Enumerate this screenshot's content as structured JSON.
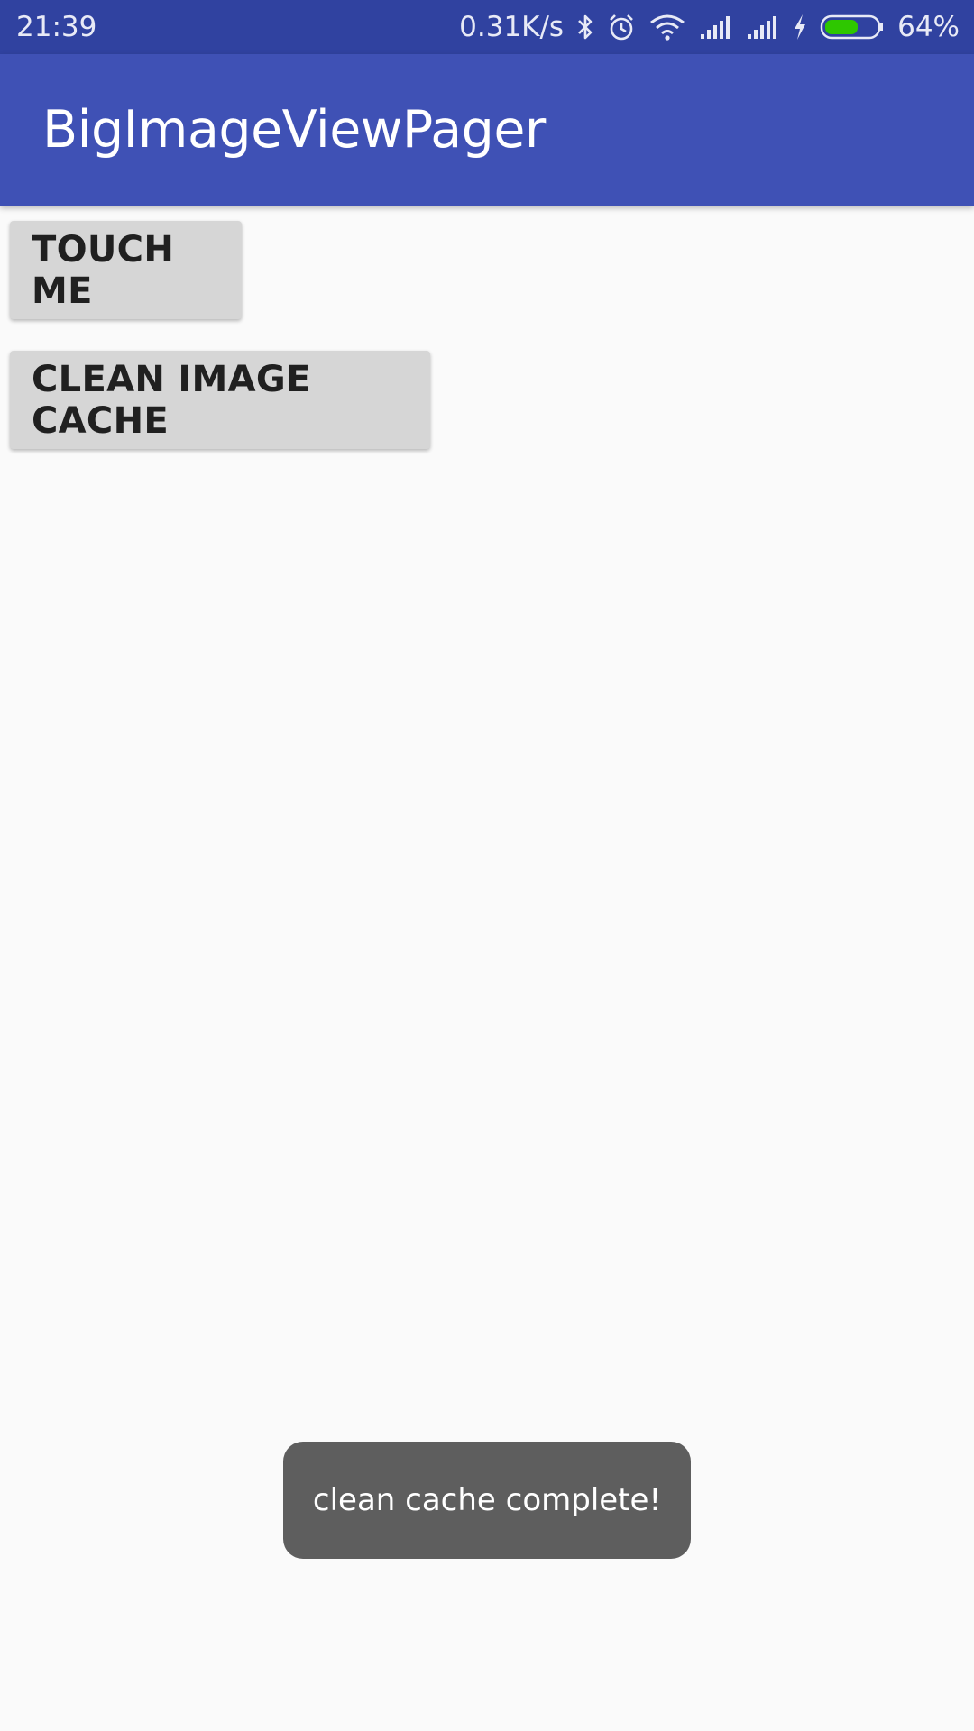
{
  "status_bar": {
    "time": "21:39",
    "network_speed": "0.31K/s",
    "battery_percent": "64%",
    "battery_level": 0.64,
    "icons": [
      "bluetooth-icon",
      "alarm-icon",
      "wifi-icon",
      "signal-icon",
      "signal-icon",
      "charging-icon",
      "battery-icon"
    ],
    "battery_color": "#2ec700"
  },
  "app_bar": {
    "title": "BigImageViewPager",
    "color": "#3f51b5"
  },
  "buttons": {
    "touch_me": "TOUCH ME",
    "clean_cache": "CLEAN IMAGE CACHE"
  },
  "toast": {
    "message": "clean cache complete!"
  }
}
